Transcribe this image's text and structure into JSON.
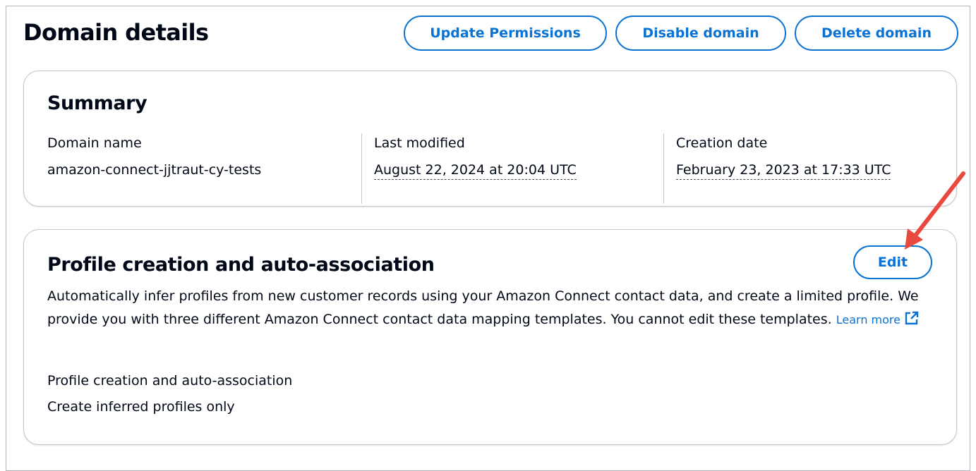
{
  "page": {
    "title": "Domain details"
  },
  "header": {
    "update_permissions_label": "Update Permissions",
    "disable_domain_label": "Disable domain",
    "delete_domain_label": "Delete domain"
  },
  "summary": {
    "heading": "Summary",
    "fields": [
      {
        "label": "Domain name",
        "value": "amazon-connect-jjtraut-cy-tests"
      },
      {
        "label": "Last modified",
        "value": "August 22, 2024 at 20:04 UTC"
      },
      {
        "label": "Creation date",
        "value": "February 23, 2023 at 17:33 UTC"
      }
    ]
  },
  "profile": {
    "heading": "Profile creation and auto-association",
    "edit_label": "Edit",
    "description": "Automatically infer profiles from new customer records using your Amazon Connect contact data, and create a limited profile. We provide you with three different Amazon Connect contact data mapping templates. You cannot edit these templates.",
    "learn_more_label": "Learn more",
    "field_label": "Profile creation and auto-association",
    "field_value": "Create inferred profiles only"
  },
  "colors": {
    "accent": "#0972d3",
    "text": "#000716",
    "border": "#c6c6cd",
    "annotation_arrow": "#e8493f"
  },
  "icons": {
    "external_link": "external-link-icon",
    "annotation": "annotation-arrow-icon"
  }
}
